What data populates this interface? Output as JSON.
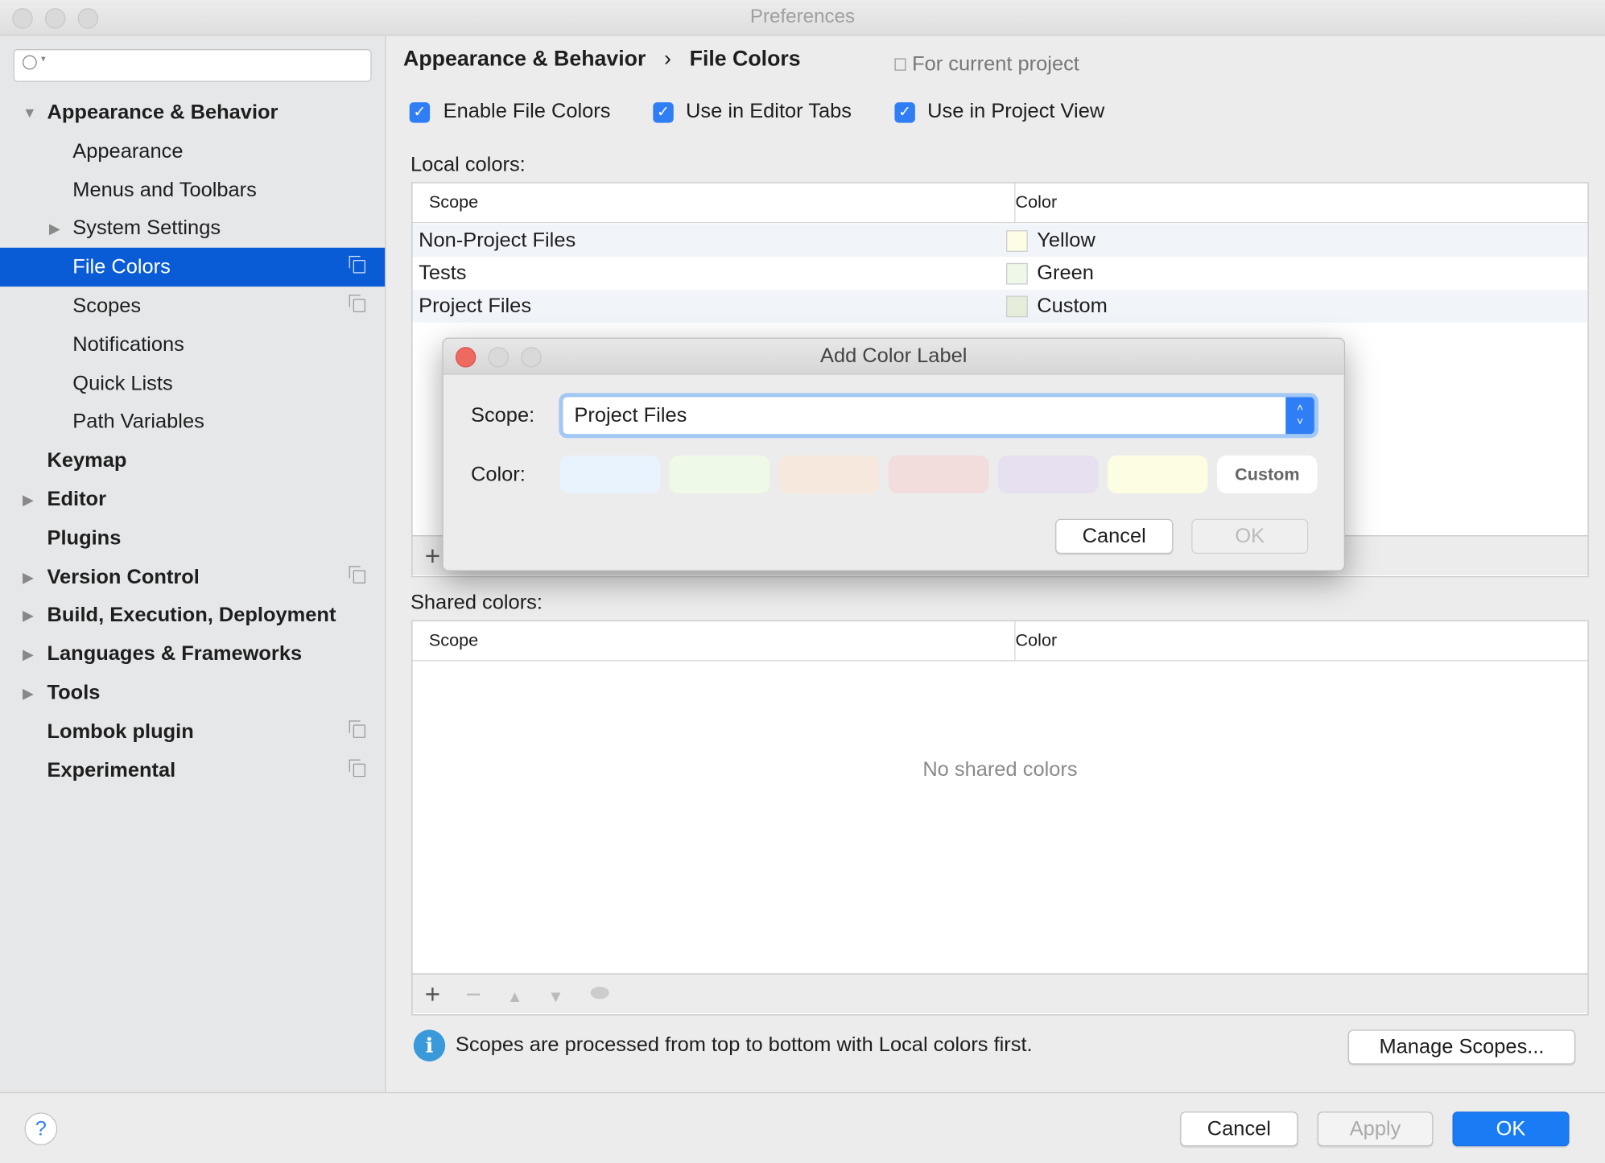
{
  "window": {
    "title": "Preferences"
  },
  "sidebar": {
    "search_placeholder": "",
    "items": [
      {
        "label": "Appearance & Behavior",
        "level": 0,
        "expanded": true
      },
      {
        "label": "Appearance",
        "level": 1
      },
      {
        "label": "Menus and Toolbars",
        "level": 1
      },
      {
        "label": "System Settings",
        "level": 1,
        "expandable": true
      },
      {
        "label": "File Colors",
        "level": 1,
        "selected": true,
        "project_icon": true
      },
      {
        "label": "Scopes",
        "level": 1,
        "project_icon": true
      },
      {
        "label": "Notifications",
        "level": 1
      },
      {
        "label": "Quick Lists",
        "level": 1
      },
      {
        "label": "Path Variables",
        "level": 1
      },
      {
        "label": "Keymap",
        "level": 0
      },
      {
        "label": "Editor",
        "level": 0,
        "expandable": true
      },
      {
        "label": "Plugins",
        "level": 0
      },
      {
        "label": "Version Control",
        "level": 0,
        "expandable": true,
        "project_icon": true
      },
      {
        "label": "Build, Execution, Deployment",
        "level": 0,
        "expandable": true
      },
      {
        "label": "Languages & Frameworks",
        "level": 0,
        "expandable": true
      },
      {
        "label": "Tools",
        "level": 0,
        "expandable": true
      },
      {
        "label": "Lombok plugin",
        "level": 0,
        "project_icon": true
      },
      {
        "label": "Experimental",
        "level": 0,
        "project_icon": true
      }
    ]
  },
  "header": {
    "breadcrumb": [
      "Appearance & Behavior",
      "File Colors"
    ],
    "separator": "›",
    "scope_note": "For current project"
  },
  "options": [
    {
      "label": "Enable File Colors",
      "checked": true
    },
    {
      "label": "Use in Editor Tabs",
      "checked": true
    },
    {
      "label": "Use in Project View",
      "checked": true
    }
  ],
  "local": {
    "label": "Local colors:",
    "columns": [
      "Scope",
      "Color"
    ],
    "rows": [
      {
        "scope": "Non-Project Files",
        "color": "Yellow",
        "swatch": "#fdfde6"
      },
      {
        "scope": "Tests",
        "color": "Green",
        "swatch": "#eef7e8"
      },
      {
        "scope": "Project Files",
        "color": "Custom",
        "swatch": "#e6eedb"
      }
    ],
    "toolbar": {
      "add": "+"
    }
  },
  "shared": {
    "label": "Shared colors:",
    "columns": [
      "Scope",
      "Color"
    ],
    "empty": "No shared colors",
    "toolbar": {
      "add": "+",
      "remove": "−",
      "up": "▲",
      "down": "▼"
    }
  },
  "info": {
    "text": "Scopes are processed from top to bottom with Local colors first.",
    "manage": "Manage Scopes..."
  },
  "footer": {
    "help": "?",
    "cancel": "Cancel",
    "apply": "Apply",
    "ok": "OK"
  },
  "dialog": {
    "title": "Add Color Label",
    "scope_label": "Scope:",
    "scope_value": "Project Files",
    "color_label": "Color:",
    "swatches": [
      "#e8f3fe",
      "#eef9e8",
      "#f6e8dc",
      "#f2dcdc",
      "#e6e0f0",
      "#fdfde4"
    ],
    "custom": "Custom",
    "cancel": "Cancel",
    "ok": "OK"
  },
  "colors": {
    "accent": "#0a5cd6",
    "checkbox": "#2f7ef6",
    "ok_button": "#1a7cf5",
    "close": "#ed6a5e"
  }
}
